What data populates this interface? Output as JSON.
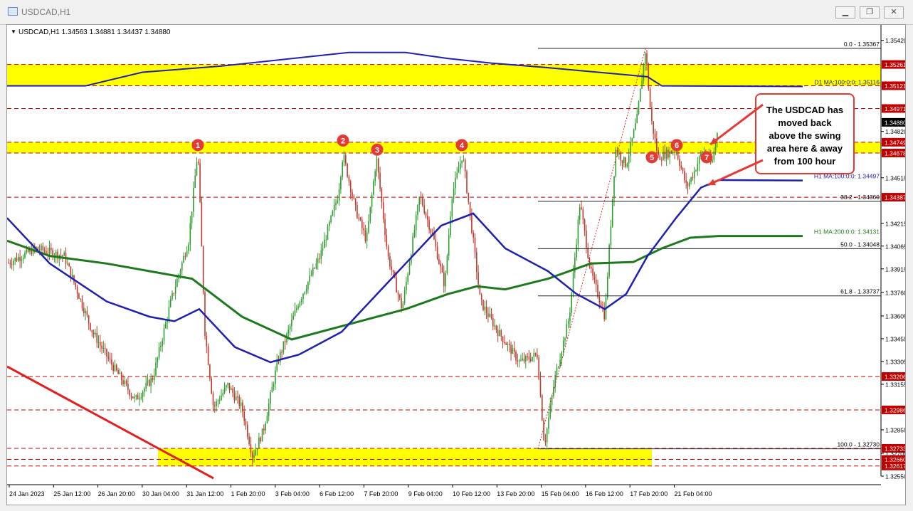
{
  "window": {
    "title": "USDCAD,H1",
    "minimize_symbol": "▁",
    "restore_symbol": "❐",
    "close_symbol": "✕"
  },
  "chart_info": {
    "symbol_line": "USDCAD,H1  1.34563 1.34881 1.34437 1.34880",
    "menu_arrow": "▼"
  },
  "colors": {
    "candle_up": "#2e9d2e",
    "candle_down": "#c0392b",
    "ma100": "#1f1fb0",
    "ma200": "#1c7a1c",
    "zone": "#ffff00",
    "level_line": "#c00000",
    "callout_border": "#e53935",
    "marker_fill": "#e53935"
  },
  "chart_data": {
    "type": "candlestick",
    "symbol": "USDCAD",
    "timeframe": "H1",
    "ohlc_last": {
      "open": 1.34563,
      "high": 1.34881,
      "low": 1.34437,
      "close": 1.3488
    },
    "ylim": [
      1.3255,
      1.3547
    ],
    "y_ticks": [
      "1.35420",
      "1.35261",
      "1.35121",
      "1.34971",
      "1.34880",
      "1.34820",
      "1.34749",
      "1.34678",
      "1.34515",
      "1.34387",
      "1.34215",
      "1.34065",
      "1.33915",
      "1.33760",
      "1.33605",
      "1.33455",
      "1.33305",
      "1.33206",
      "1.33155",
      "1.32986",
      "1.32855",
      "1.32733",
      "1.32700",
      "1.32660",
      "1.32617",
      "1.32550"
    ],
    "x_ticks": [
      "24 Jan 2023",
      "25 Jan 12:00",
      "26 Jan 20:00",
      "30 Jan 04:00",
      "31 Jan 12:00",
      "1 Feb 20:00",
      "3 Feb 04:00",
      "6 Feb 12:00",
      "7 Feb 20:00",
      "9 Feb 04:00",
      "10 Feb 12:00",
      "13 Feb 20:00",
      "15 Feb 04:00",
      "16 Feb 12:00",
      "17 Feb 20:00",
      "21 Feb 04:00"
    ],
    "price_path": [
      [
        0,
        1.3395
      ],
      [
        40,
        1.3405
      ],
      [
        80,
        1.34
      ],
      [
        120,
        1.335
      ],
      [
        145,
        1.333
      ],
      [
        180,
        1.3305
      ],
      [
        205,
        1.332
      ],
      [
        230,
        1.337
      ],
      [
        255,
        1.341
      ],
      [
        268,
        1.347
      ],
      [
        278,
        1.335
      ],
      [
        290,
        1.33
      ],
      [
        310,
        1.3315
      ],
      [
        330,
        1.33
      ],
      [
        345,
        1.3268
      ],
      [
        360,
        1.3285
      ],
      [
        380,
        1.333
      ],
      [
        410,
        1.337
      ],
      [
        440,
        1.34
      ],
      [
        465,
        1.344
      ],
      [
        472,
        1.3467
      ],
      [
        490,
        1.343
      ],
      [
        505,
        1.341
      ],
      [
        519,
        1.3465
      ],
      [
        535,
        1.34
      ],
      [
        555,
        1.3365
      ],
      [
        580,
        1.344
      ],
      [
        600,
        1.341
      ],
      [
        615,
        1.338
      ],
      [
        625,
        1.344
      ],
      [
        640,
        1.3467
      ],
      [
        655,
        1.341
      ],
      [
        665,
        1.337
      ],
      [
        690,
        1.335
      ],
      [
        720,
        1.333
      ],
      [
        745,
        1.3335
      ],
      [
        755,
        1.3275
      ],
      [
        770,
        1.332
      ],
      [
        790,
        1.336
      ],
      [
        805,
        1.3435
      ],
      [
        820,
        1.339
      ],
      [
        840,
        1.336
      ],
      [
        855,
        1.347
      ],
      [
        870,
        1.346
      ],
      [
        885,
        1.349
      ],
      [
        897,
        1.3536
      ],
      [
        905,
        1.349
      ],
      [
        915,
        1.3465
      ],
      [
        940,
        1.347
      ],
      [
        955,
        1.3445
      ],
      [
        965,
        1.3455
      ],
      [
        978,
        1.347
      ],
      [
        990,
        1.346
      ],
      [
        1000,
        1.3488
      ]
    ],
    "ma100_path": [
      [
        0,
        1.3425
      ],
      [
        60,
        1.3395
      ],
      [
        140,
        1.337
      ],
      [
        200,
        1.336
      ],
      [
        235,
        1.3357
      ],
      [
        270,
        1.3365
      ],
      [
        320,
        1.334
      ],
      [
        370,
        1.333
      ],
      [
        410,
        1.3335
      ],
      [
        470,
        1.335
      ],
      [
        520,
        1.3375
      ],
      [
        560,
        1.3395
      ],
      [
        610,
        1.342
      ],
      [
        655,
        1.3428
      ],
      [
        700,
        1.3405
      ],
      [
        760,
        1.339
      ],
      [
        800,
        1.3375
      ],
      [
        840,
        1.3365
      ],
      [
        870,
        1.3375
      ],
      [
        900,
        1.34
      ],
      [
        940,
        1.3425
      ],
      [
        975,
        1.3445
      ],
      [
        1000,
        1.345
      ],
      [
        1118,
        1.34497
      ]
    ],
    "ma200_path": [
      [
        0,
        1.341
      ],
      [
        60,
        1.34
      ],
      [
        140,
        1.3395
      ],
      [
        200,
        1.339
      ],
      [
        260,
        1.3385
      ],
      [
        330,
        1.336
      ],
      [
        400,
        1.3345
      ],
      [
        480,
        1.3355
      ],
      [
        560,
        1.3365
      ],
      [
        620,
        1.3375
      ],
      [
        660,
        1.338
      ],
      [
        700,
        1.3378
      ],
      [
        760,
        1.3385
      ],
      [
        820,
        1.3395
      ],
      [
        880,
        1.3396
      ],
      [
        920,
        1.3405
      ],
      [
        960,
        1.3412
      ],
      [
        1000,
        1.34131
      ],
      [
        1118,
        1.34131
      ]
    ],
    "d1_ma_path": [
      [
        0,
        1.3512
      ],
      [
        110,
        1.3512
      ],
      [
        190,
        1.3521
      ],
      [
        300,
        1.3525
      ],
      [
        420,
        1.3531
      ],
      [
        480,
        1.3534
      ],
      [
        560,
        1.3534
      ],
      [
        620,
        1.353
      ],
      [
        680,
        1.3527
      ],
      [
        760,
        1.3524
      ],
      [
        900,
        1.3518
      ],
      [
        920,
        1.3512
      ],
      [
        1118,
        1.35116
      ]
    ],
    "zones": [
      {
        "y1": 1.35261,
        "y2": 1.35121
      },
      {
        "y1": 1.34749,
        "y2": 1.34678
      },
      {
        "y1": 1.32733,
        "y2": 1.32617
      }
    ],
    "levels": [
      "1.35261",
      "1.35121",
      "1.34971",
      "1.34749",
      "1.34678",
      "1.34387",
      "1.33206",
      "1.32986",
      "1.32733",
      "1.32660",
      "1.32617"
    ],
    "fibonacci": [
      {
        "label": "0.0 - 1.35367",
        "price": 1.35367
      },
      {
        "label": "38.2 - 1.34360",
        "price": 1.3436
      },
      {
        "label": "50.0 - 1.34048",
        "price": 1.34048
      },
      {
        "label": "61.8 - 1.33737",
        "price": 1.33737
      },
      {
        "label": "100.0 - 1.32730",
        "price": 1.3273
      }
    ],
    "ma_labels": [
      {
        "text": "D1 MA:100:0:0: 1.35116",
        "price": 1.35116,
        "color": "#1f1fb0"
      },
      {
        "text": "H1 MA:100:0:0: 1.34497",
        "price": 1.34497,
        "color": "#1f1fb0"
      },
      {
        "text": "H1 MA:200:0:0: 1.34131",
        "price": 1.34131,
        "color": "#1c7a1c"
      }
    ],
    "markers": [
      {
        "label": "1",
        "x": 268,
        "price": 1.3473
      },
      {
        "label": "2",
        "x": 472,
        "price": 1.3476
      },
      {
        "label": "3",
        "x": 520,
        "price": 1.347
      },
      {
        "label": "4",
        "x": 639,
        "price": 1.3473
      },
      {
        "label": "5",
        "x": 906,
        "price": 1.3465
      },
      {
        "label": "6",
        "x": 941,
        "price": 1.3473
      },
      {
        "label": "7",
        "x": 983,
        "price": 1.3465
      }
    ],
    "callout": [
      "The USDCAD has",
      "moved back",
      "above the swing",
      "area here & away",
      "from 100 hour"
    ]
  }
}
